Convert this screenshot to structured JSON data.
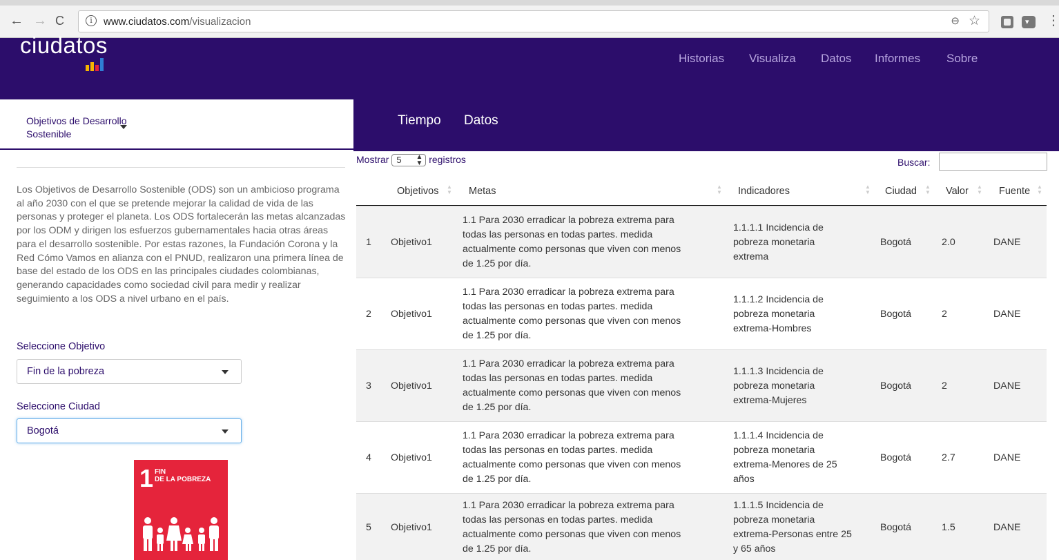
{
  "browser": {
    "url_host": "www.ciudatos.com",
    "url_path": "/visualizacion",
    "back_icon": "back-arrow-icon",
    "forward_icon": "forward-arrow-icon",
    "reload_icon": "reload-icon"
  },
  "header": {
    "logo": "ciudatos",
    "logo_colors": [
      "#f7b500",
      "#e5243b",
      "#2f7fd6"
    ],
    "nav": [
      "Historias",
      "Visualiza",
      "Datos",
      "Informes",
      "Sobre"
    ]
  },
  "sidebar": {
    "top_selector": "Objetivos de Desarrollo Sostenible",
    "description": "Los Objetivos de Desarrollo Sostenible (ODS) son un ambicioso programa al año 2030 con el que se pretende mejorar la calidad de vida de las personas y proteger el planeta. Los ODS fortalecerán las metas alcanzadas por los ODM y dirigen los esfuerzos gubernamentales hacia otras áreas para el desarrollo sostenible. Por estas razones, la Fundación Corona y la Red Cómo Vamos en alianza con el PNUD, realizaron una primera línea de base del estado de los ODS en las principales ciudades colombianas, generando capacidades como sociedad civil para medir y realizar seguimiento a los ODS a nivel urbano en el país.",
    "objective_label": "Seleccione Objetivo",
    "objective_value": "Fin de la pobreza",
    "city_label": "Seleccione Ciudad",
    "city_value": "Bogotá",
    "sdg_number": "1",
    "sdg_text_1": "FIN",
    "sdg_text_2": "DE LA POBREZA",
    "sdg_color": "#e5243b"
  },
  "tabs": [
    "Tiempo",
    "Datos"
  ],
  "table": {
    "show_label": "Mostrar",
    "show_value": "5",
    "records_label": "registros",
    "search_label": "Buscar:",
    "columns": [
      "Objetivos",
      "Metas",
      "Indicadores",
      "Ciudad",
      "Valor",
      "Fuente"
    ],
    "rows": [
      {
        "n": "1",
        "objetivo": "Objetivo1",
        "meta": [
          "1.1 Para 2030 erradicar la pobreza extrema para",
          "todas las personas en todas partes. medida",
          "actualmente como personas que viven con menos",
          "de 1.25 por día."
        ],
        "indicador": [
          "1.1.1.1 Incidencia de",
          "pobreza monetaria",
          "extrema"
        ],
        "ciudad": "Bogotá",
        "valor": "2.0",
        "fuente": "DANE"
      },
      {
        "n": "2",
        "objetivo": "Objetivo1",
        "meta": [
          "1.1 Para 2030 erradicar la pobreza extrema para",
          "todas las personas en todas partes. medida",
          "actualmente como personas que viven con menos",
          "de 1.25 por día."
        ],
        "indicador": [
          "1.1.1.2 Incidencia de",
          "pobreza monetaria",
          "extrema-Hombres"
        ],
        "ciudad": "Bogotá",
        "valor": "2",
        "fuente": "DANE"
      },
      {
        "n": "3",
        "objetivo": "Objetivo1",
        "meta": [
          "1.1 Para 2030 erradicar la pobreza extrema para",
          "todas las personas en todas partes. medida",
          "actualmente como personas que viven con menos",
          "de 1.25 por día."
        ],
        "indicador": [
          "1.1.1.3 Incidencia de",
          "pobreza monetaria",
          "extrema-Mujeres"
        ],
        "ciudad": "Bogotá",
        "valor": "2",
        "fuente": "DANE"
      },
      {
        "n": "4",
        "objetivo": "Objetivo1",
        "meta": [
          "1.1 Para 2030 erradicar la pobreza extrema para",
          "todas las personas en todas partes. medida",
          "actualmente como personas que viven con menos",
          "de 1.25 por día."
        ],
        "indicador": [
          "1.1.1.4 Incidencia de",
          "pobreza monetaria",
          "extrema-Menores de 25",
          "años"
        ],
        "ciudad": "Bogotá",
        "valor": "2.7",
        "fuente": "DANE"
      },
      {
        "n": "5",
        "objetivo": "Objetivo1",
        "meta": [
          "1.1 Para 2030 erradicar la pobreza extrema para",
          "todas las personas en todas partes. medida",
          "actualmente como personas que viven con menos",
          "de 1.25 por día."
        ],
        "indicador": [
          "1.1.1.5 Incidencia de",
          "pobreza monetaria",
          "extrema-Personas entre 25",
          "y 65 años"
        ],
        "ciudad": "Bogotá",
        "valor": "1.5",
        "fuente": "DANE"
      }
    ]
  }
}
